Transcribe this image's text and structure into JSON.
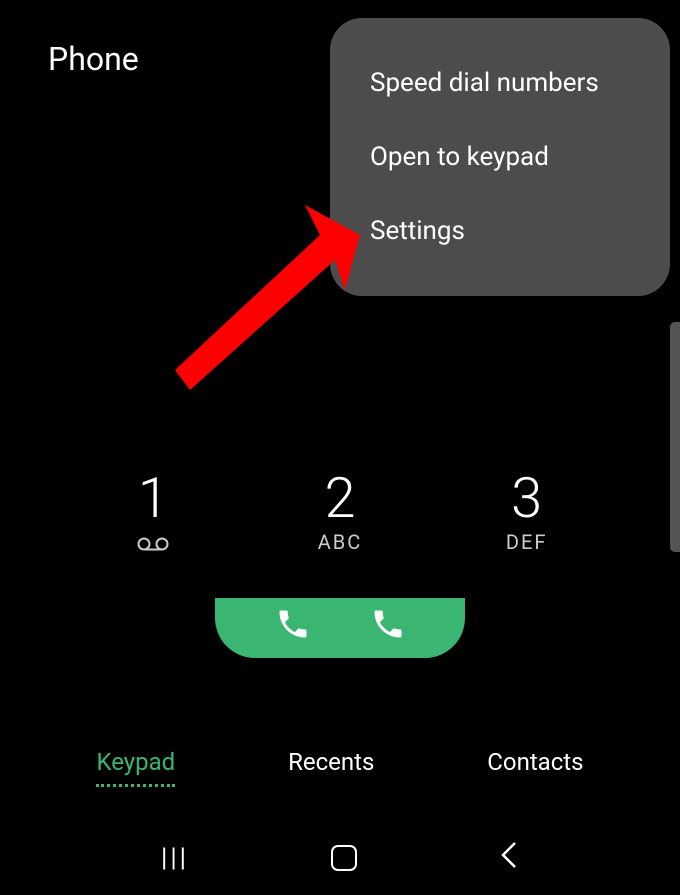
{
  "header": {
    "title": "Phone"
  },
  "dropdown": {
    "items": [
      {
        "label": "Speed dial numbers"
      },
      {
        "label": "Open to keypad"
      },
      {
        "label": "Settings"
      }
    ]
  },
  "keypad": {
    "keys": [
      {
        "digit": "1",
        "sub": ""
      },
      {
        "digit": "2",
        "sub": "ABC"
      },
      {
        "digit": "3",
        "sub": "DEF"
      }
    ]
  },
  "tabs": {
    "keypad": "Keypad",
    "recents": "Recents",
    "contacts": "Contacts"
  },
  "colors": {
    "accent": "#3bb672"
  }
}
